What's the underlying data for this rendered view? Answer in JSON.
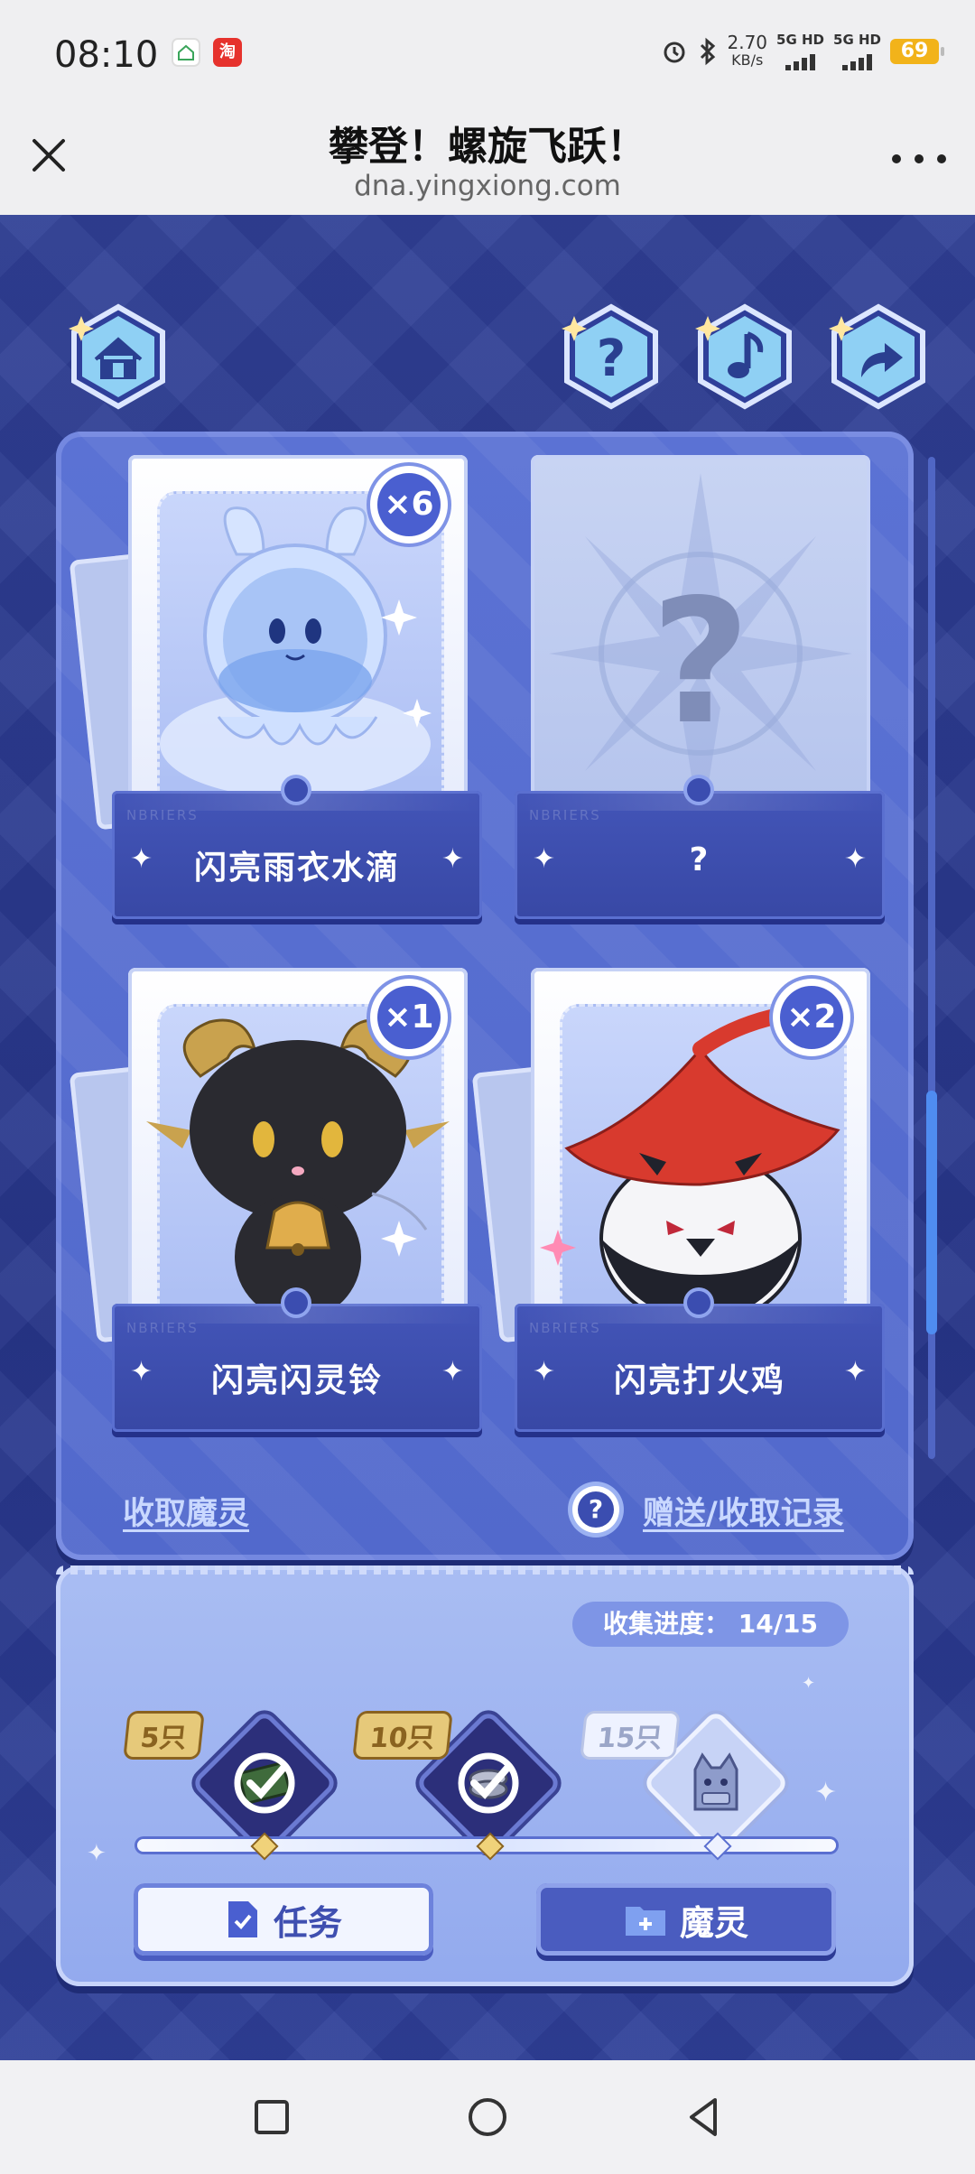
{
  "status_bar": {
    "time": "08:10",
    "speed_value": "2.70",
    "speed_unit": "KB/s",
    "net1": "5G HD",
    "net2": "5G HD",
    "battery": "69"
  },
  "title_bar": {
    "title": "攀登！螺旋飞跃！",
    "url": "dna.yingxiong.com"
  },
  "cards": [
    {
      "name": "闪亮雨衣水滴",
      "count": "×6",
      "brand": "NBRIERS"
    },
    {
      "name": "?",
      "count": "",
      "brand": "NBRIERS"
    },
    {
      "name": "闪亮闪灵铃",
      "count": "×1",
      "brand": "NBRIERS"
    },
    {
      "name": "闪亮打火鸡",
      "count": "×2",
      "brand": "NBRIERS"
    }
  ],
  "links": {
    "collect": "收取魔灵",
    "record": "赠送/收取记录",
    "help": "?"
  },
  "progress": {
    "label": "收集进度：",
    "value": "14/15",
    "fraction": 0.933
  },
  "rewards": [
    {
      "tag": "5只",
      "claimed": true
    },
    {
      "tag": "10只",
      "claimed": true
    },
    {
      "tag": "15只",
      "claimed": false
    }
  ],
  "buttons": {
    "task": "任务",
    "spirit": "魔灵"
  },
  "colors": {
    "panel": "#5269cc",
    "background": "#2a3a8a",
    "accent_gold": "#e8c777"
  }
}
